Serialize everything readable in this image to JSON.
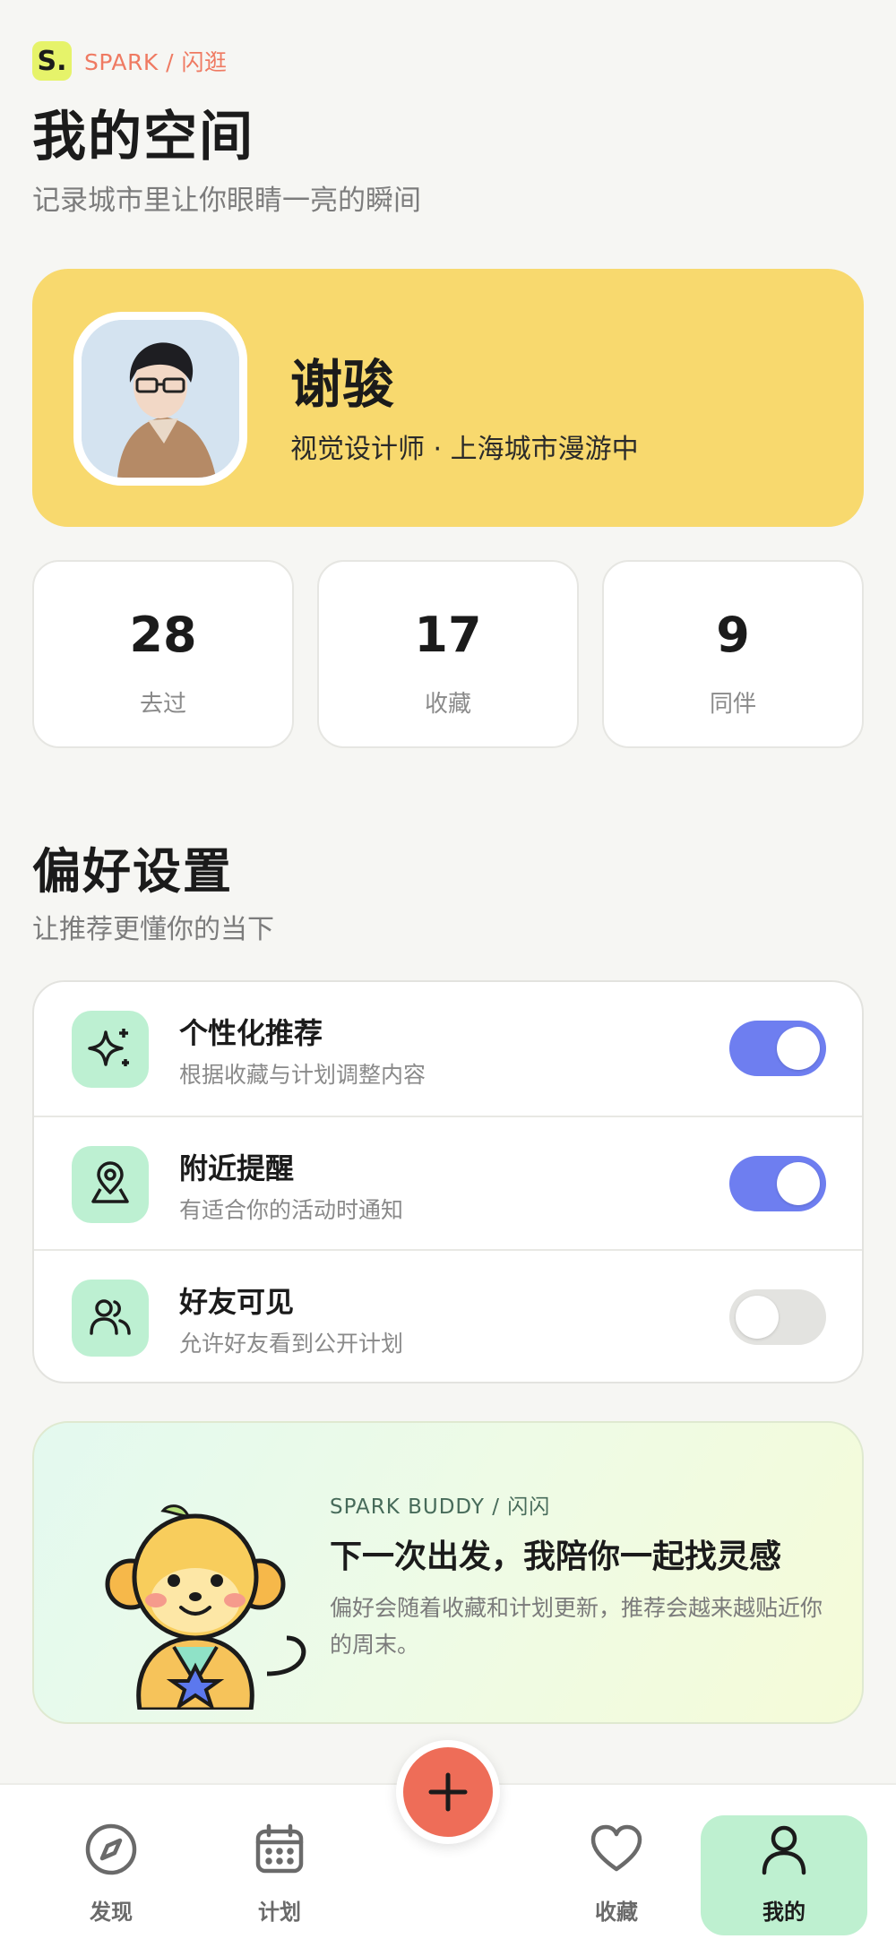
{
  "header": {
    "brand_logo": "S.",
    "brand": "SPARK / 闪逛",
    "title": "我的空间",
    "subtitle": "记录城市里让你眼睛一亮的瞬间"
  },
  "profile": {
    "name": "谢骏",
    "bio": "视觉设计师 · 上海城市漫游中"
  },
  "stats": [
    {
      "value": "28",
      "label": "去过"
    },
    {
      "value": "17",
      "label": "收藏"
    },
    {
      "value": "9",
      "label": "同伴"
    }
  ],
  "preferences": {
    "title": "偏好设置",
    "subtitle": "让推荐更懂你的当下",
    "items": [
      {
        "icon": "sparkle-icon",
        "title": "个性化推荐",
        "desc": "根据收藏与计划调整内容",
        "enabled": true
      },
      {
        "icon": "location-pin-icon",
        "title": "附近提醒",
        "desc": "有适合你的活动时通知",
        "enabled": true
      },
      {
        "icon": "people-icon",
        "title": "好友可见",
        "desc": "允许好友看到公开计划",
        "enabled": false
      }
    ]
  },
  "buddy": {
    "eyebrow": "SPARK BUDDY / 闪闪",
    "title": "下一次出发，我陪你一起找灵感",
    "desc": "偏好会随着收藏和计划更新，推荐会越来越贴近你的周末。"
  },
  "nav": {
    "items": [
      {
        "icon": "compass-icon",
        "label": "发现"
      },
      {
        "icon": "calendar-icon",
        "label": "计划"
      },
      {
        "icon": "heart-icon",
        "label": "收藏"
      },
      {
        "icon": "user-icon",
        "label": "我的"
      }
    ],
    "active": "我的",
    "fab_icon": "plus-icon"
  },
  "colors": {
    "accent_yellow": "#f8d96e",
    "toggle_on": "#6e7ef0",
    "mint": "#bdf0d2",
    "fab": "#ee6d58",
    "brand_text": "#ef7a62"
  }
}
